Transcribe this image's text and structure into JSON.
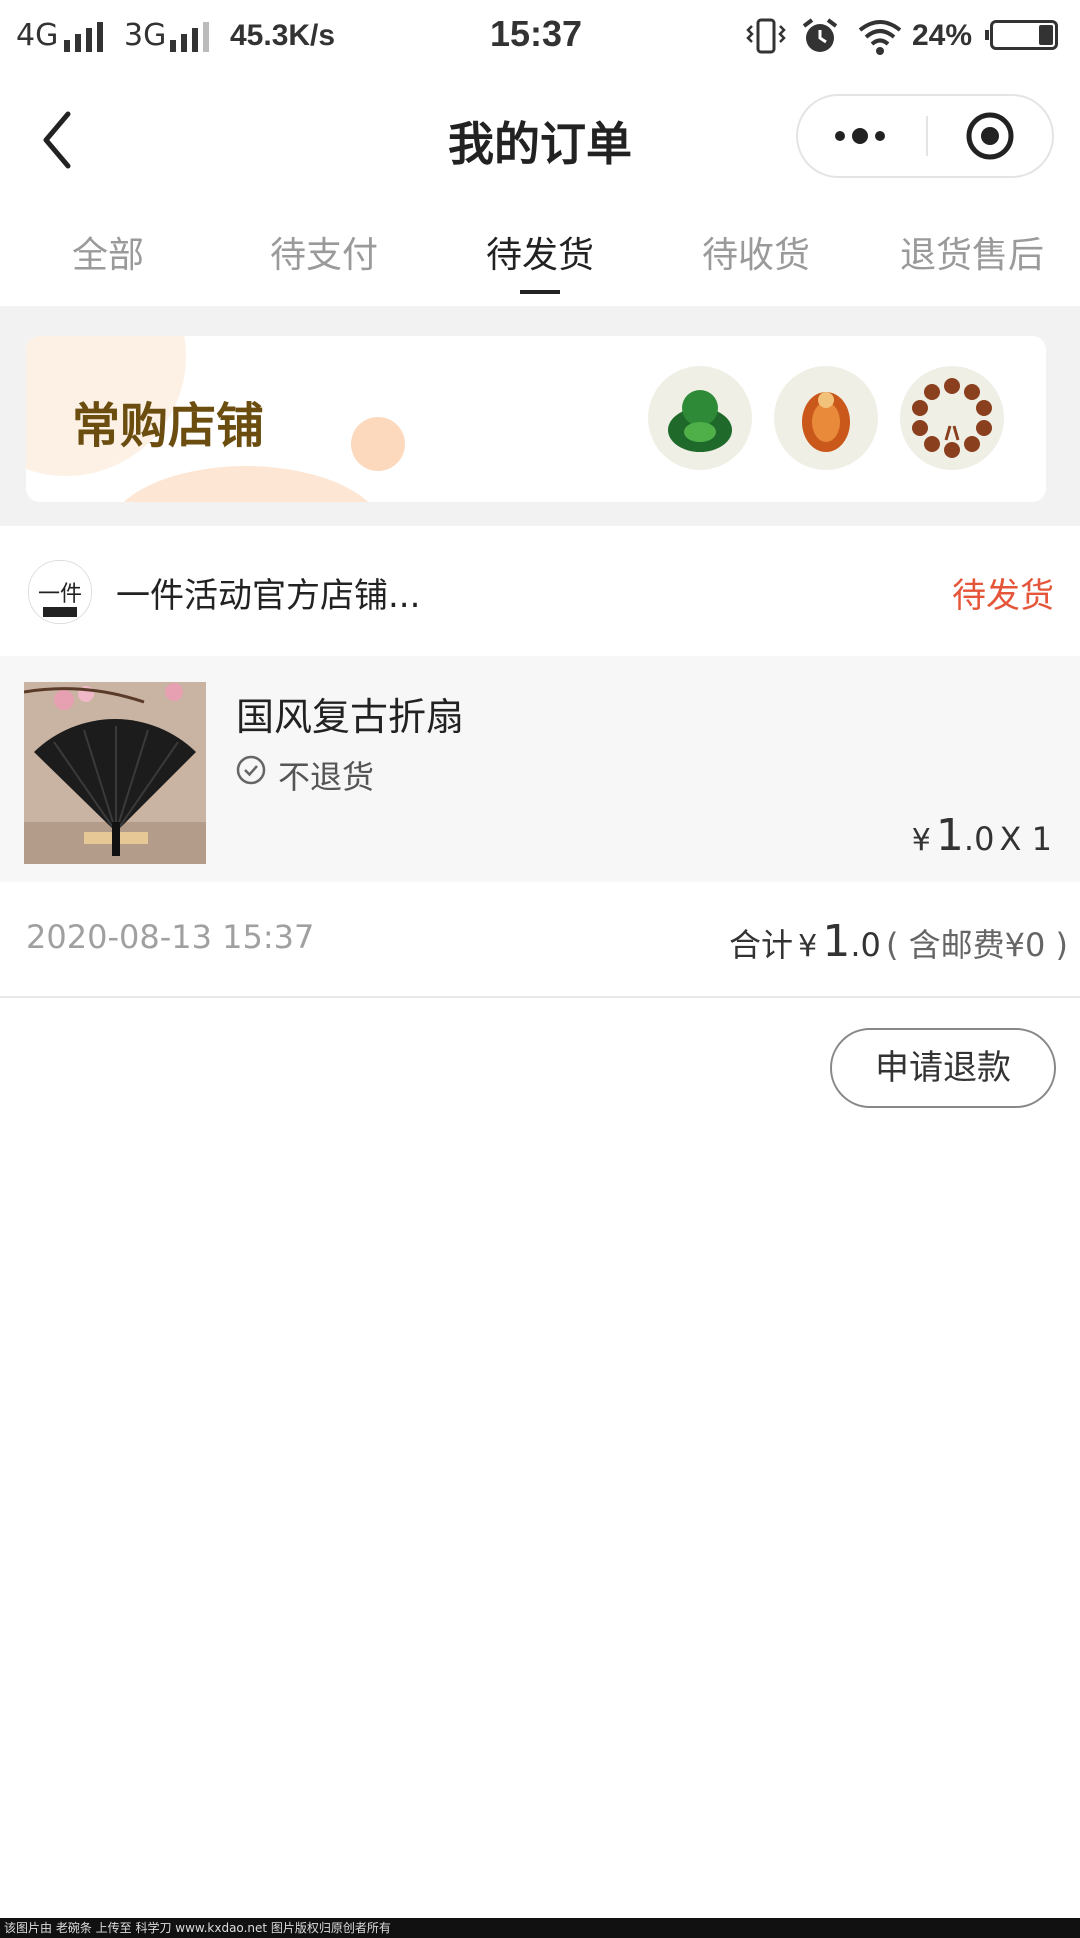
{
  "status_bar": {
    "net1": "4G",
    "net2": "3G",
    "speed": "45.3K/s",
    "time": "15:37",
    "battery": "24%",
    "battery_level": 0.24
  },
  "nav": {
    "title": "我的订单"
  },
  "tabs": [
    {
      "label": "全部"
    },
    {
      "label": "待支付"
    },
    {
      "label": "待发货",
      "active": true
    },
    {
      "label": "待收货"
    },
    {
      "label": "退货售后"
    }
  ],
  "banner": {
    "title": "常购店铺"
  },
  "order": {
    "store_logo_text": "一件",
    "store_name": "一件活动官方店铺...",
    "status": "待发货",
    "product": {
      "name": "国风复古折扇",
      "policy": "不退货",
      "currency": "¥",
      "price_int": "1",
      "price_dec": ".0",
      "quantity": "X 1"
    },
    "date": "2020-08-13 15:37",
    "total_label": "合计",
    "total_currency": "¥",
    "total_int": "1",
    "total_dec": ".0",
    "shipping": "( 含邮费¥0 )",
    "refund_button": "申请退款"
  },
  "watermark": "该图片由 老碗条 上传至 科学刀 www.kxdao.net 图片版权归原创者所有",
  "colors": {
    "status_accent": "#e5553a",
    "banner_title": "#6b4d10",
    "background_band": "#f2f2f2"
  }
}
